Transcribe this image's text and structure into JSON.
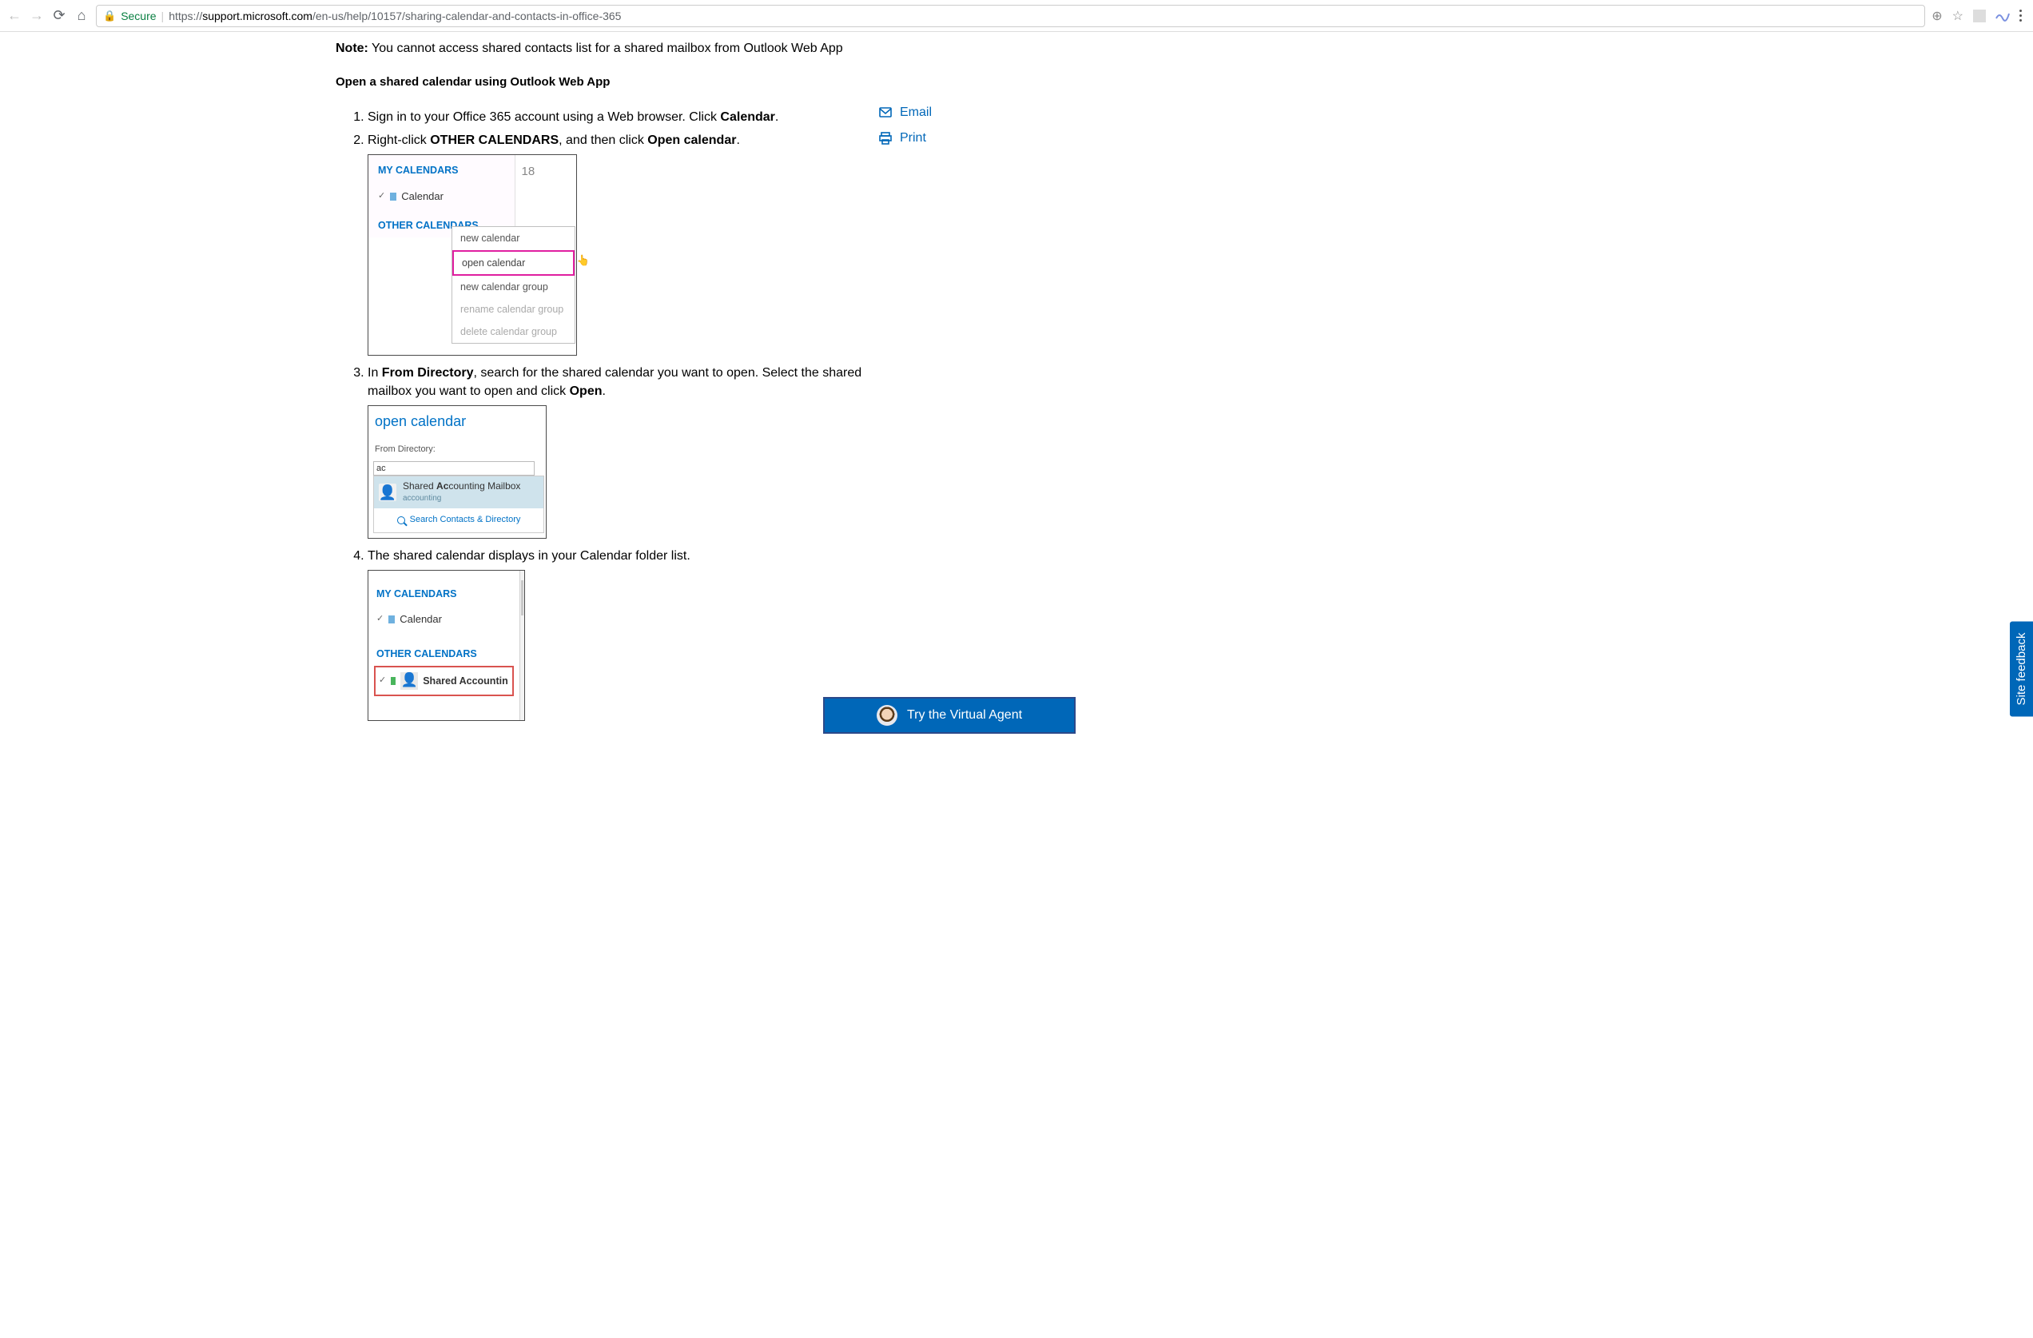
{
  "browser": {
    "secure_label": "Secure",
    "url_scheme": "https://",
    "url_host": "support.microsoft.com",
    "url_path": "/en-us/help/10157/sharing-calendar-and-contacts-in-office-365"
  },
  "note": {
    "prefix": "Note:",
    "text": " You cannot access shared contacts list for a shared mailbox from Outlook Web App"
  },
  "section_heading": "Open a shared calendar using Outlook Web App",
  "sidebar": {
    "email": "Email",
    "print": "Print"
  },
  "steps": {
    "s1a": "Sign in to your Office 365 account using a Web browser. Click ",
    "s1b": "Calendar",
    "s2a": "Right-click ",
    "s2b": "OTHER CALENDARS",
    "s2c": ", and then click ",
    "s2d": "Open calendar",
    "s3a": "In ",
    "s3b": "From Directory",
    "s3c": ", search for the shared calendar you want to open. Select the shared mailbox you want to open and click ",
    "s3d": "Open",
    "s4": "The shared calendar displays in your Calendar folder list."
  },
  "fig1": {
    "my_calendars": "MY CALENDARS",
    "calendar_item": "Calendar",
    "day_number": "18",
    "other_calendars": "OTHER CALENDARS",
    "menu": {
      "new_calendar": "new calendar",
      "open_calendar": "open calendar",
      "new_group": "new calendar group",
      "rename_group": "rename calendar group",
      "delete_group": "delete calendar group"
    }
  },
  "fig2": {
    "title": "open calendar",
    "from_directory": "From Directory:",
    "input_value": "ac",
    "result_name_pre": "Shared ",
    "result_name_bold": "Ac",
    "result_name_post": "counting Mailbox",
    "result_sub": "accounting",
    "search_link": "Search Contacts & Directory"
  },
  "fig3": {
    "my_calendars": "MY CALENDARS",
    "calendar_item": "Calendar",
    "other_calendars": "OTHER CALENDARS",
    "shared_name": "Shared Accountin"
  },
  "feedback_tab": "Site feedback",
  "virtual_agent": "Try the Virtual Agent"
}
